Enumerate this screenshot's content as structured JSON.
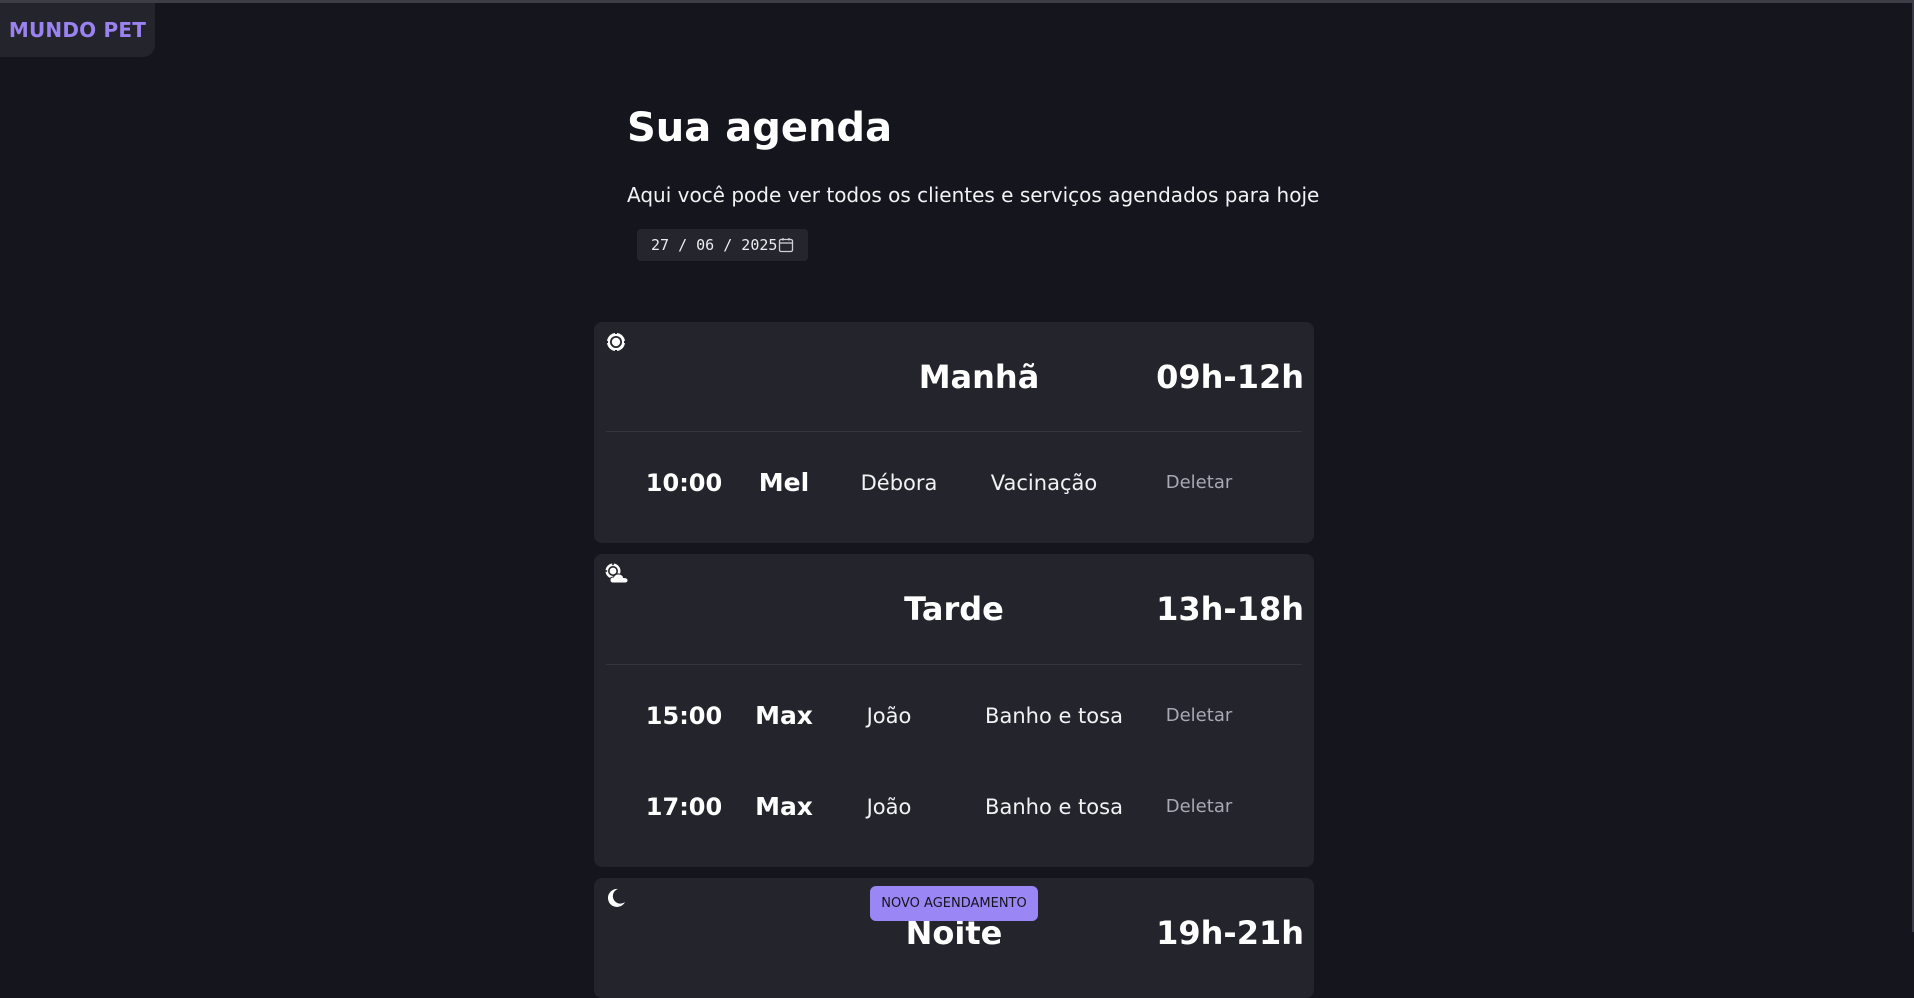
{
  "brand": {
    "name": "MUNDO PET",
    "color": "#9a82f0"
  },
  "header": {
    "title": "Sua agenda",
    "subtitle": "Aqui você pode ver todos os clientes e serviços agendados para hoje"
  },
  "date_filter": {
    "value": "27 / 06 / 2025",
    "icon": "calendar-icon"
  },
  "periods": [
    {
      "name": "Manhã",
      "hours": "09h-12h",
      "icon": "sun-icon",
      "appointments": [
        {
          "time": "10:00",
          "pet": "Mel",
          "owner": "Débora",
          "service": "Vacinação",
          "action": "Deletar"
        }
      ]
    },
    {
      "name": "Tarde",
      "hours": "13h-18h",
      "icon": "sun-cloud-icon",
      "appointments": [
        {
          "time": "15:00",
          "pet": "Max",
          "owner": "João",
          "service": "Banho e tosa",
          "action": "Deletar"
        },
        {
          "time": "17:00",
          "pet": "Max",
          "owner": "João",
          "service": "Banho e tosa",
          "action": "Deletar"
        }
      ]
    },
    {
      "name": "Noite",
      "hours": "19h-21h",
      "icon": "moon-icon",
      "appointments": []
    }
  ],
  "new_appointment_button": {
    "label": "NOVO AGENDAMENTO",
    "color": "#9b86f5"
  },
  "colors": {
    "background": "#15151d",
    "card": "#24242c",
    "accent": "#9b86f5"
  }
}
